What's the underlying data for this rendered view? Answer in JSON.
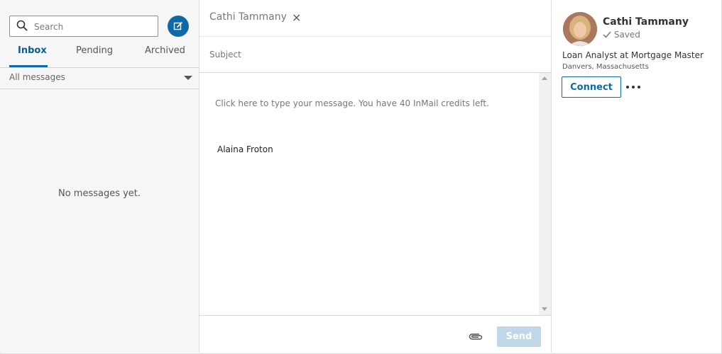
{
  "sidebar": {
    "search": {
      "placeholder": "Search"
    },
    "tabs": [
      {
        "label": "Inbox",
        "active": true
      },
      {
        "label": "Pending",
        "active": false
      },
      {
        "label": "Archived",
        "active": false
      }
    ],
    "filter_label": "All messages",
    "empty_message": "No messages yet."
  },
  "compose": {
    "recipient": "Cathi Tammany",
    "close_glyph": "×",
    "subject_placeholder": "Subject",
    "body_placeholder": "Click here to type your message. You have 40 InMail credits left.",
    "signature": "Alaina Froton",
    "send_label": "Send"
  },
  "profile": {
    "name": "Cathi Tammany",
    "saved_label": "Saved",
    "headline": "Loan Analyst at Mortgage Master",
    "location": "Danvers, Massachusetts",
    "connect_label": "Connect"
  },
  "icons": {
    "search": "search-icon",
    "compose": "compose-icon",
    "attach": "paperclip-icon",
    "more": "more-icon",
    "check": "check-icon"
  },
  "colors": {
    "accent": "#0e6aa7",
    "send_disabled": "#bfd7e8"
  }
}
